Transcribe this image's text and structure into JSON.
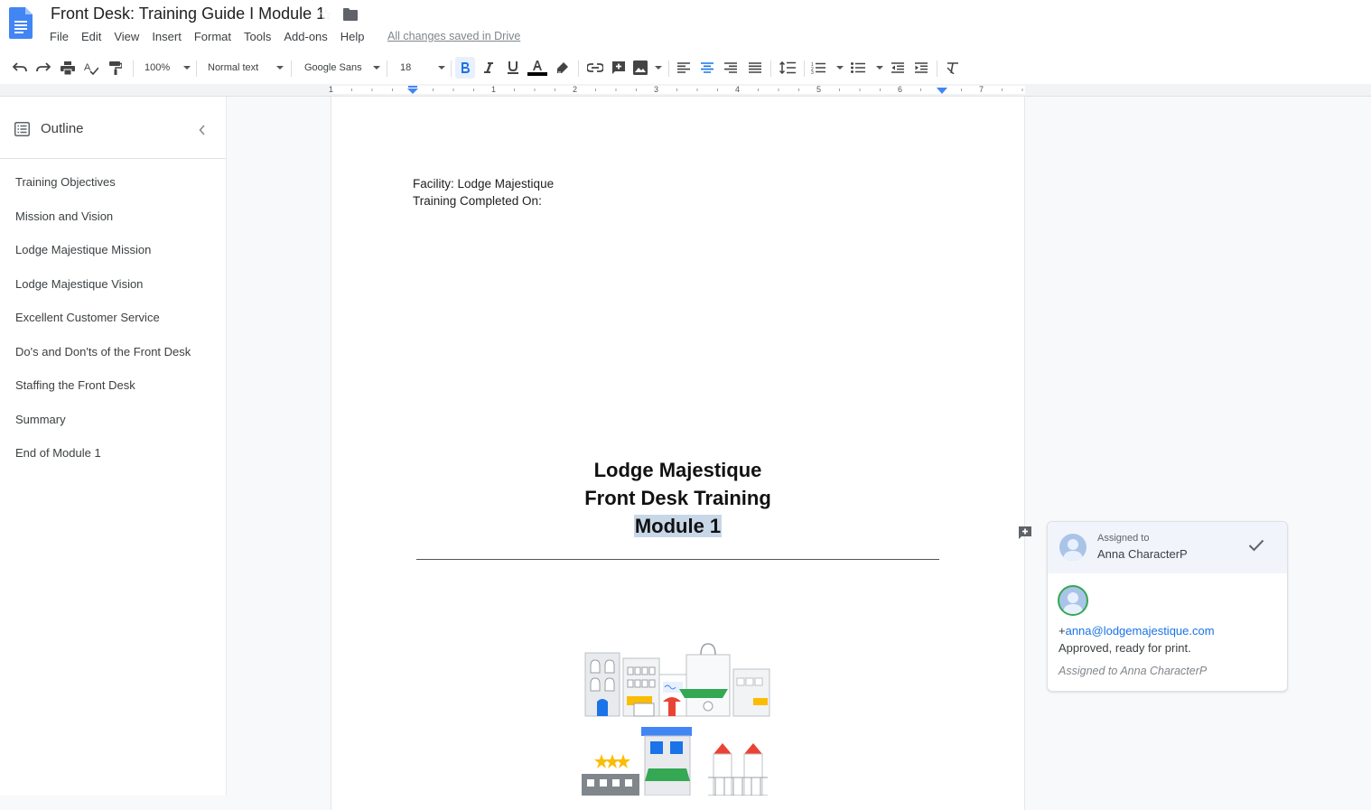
{
  "app": {
    "doc_title": "Front Desk: Training Guide I Module 1",
    "save_status": "All changes saved in Drive",
    "menu": [
      "File",
      "Edit",
      "View",
      "Insert",
      "Format",
      "Tools",
      "Add-ons",
      "Help"
    ]
  },
  "toolbar": {
    "zoom": "100%",
    "style": "Normal text",
    "font": "Google Sans",
    "font_size": "18"
  },
  "ruler": {
    "labels": [
      "1",
      "1",
      "2",
      "3",
      "4",
      "5",
      "6",
      "7"
    ]
  },
  "outline": {
    "title": "Outline",
    "items": [
      "Training Objectives",
      "Mission and Vision",
      "Lodge Majestique Mission",
      "Lodge Majestique Vision",
      "Excellent Customer Service",
      "Do's and Don'ts of the Front Desk",
      "Staffing the Front Desk",
      "Summary",
      "End of Module 1"
    ]
  },
  "document": {
    "facility_line": "Facility: Lodge Majestique",
    "completed_line": "Training Completed On:",
    "heading_line1": "Lodge Majestique",
    "heading_line2": "Front Desk Training",
    "heading_line3": "Module 1"
  },
  "comment": {
    "assigned_label": "Assigned to",
    "assignee": "Anna CharacterP",
    "mention_prefix": "+",
    "mention_email": "anna@lodgemajestique.com",
    "body": "Approved, ready for print.",
    "footer": "Assigned to Anna CharacterP"
  },
  "colors": {
    "docs_blue": "#4285f4",
    "link_blue": "#1a73e8",
    "highlight": "#c8d7e8"
  }
}
